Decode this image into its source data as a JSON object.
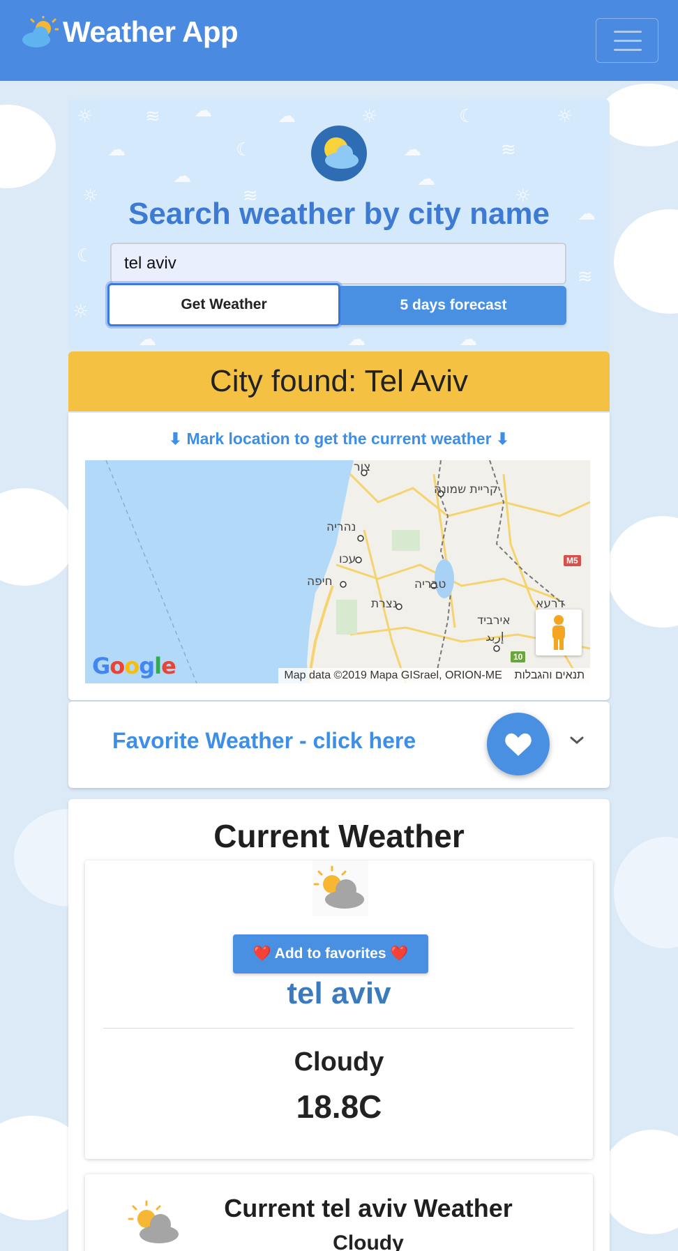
{
  "app": {
    "title": "Weather App",
    "menu_icon": "hamburger-icon"
  },
  "search": {
    "title": "Search weather by city name",
    "input_value": "tel aviv",
    "get_weather_label": "Get Weather",
    "forecast_label": "5 days forecast"
  },
  "city_found": {
    "text": "City found: Tel Aviv"
  },
  "map": {
    "instruction": "⬇ Mark location to get the current weather ⬇",
    "attribution": "Map data ©2019 Mapa GISrael, ORION-ME",
    "terms": "תנאים והגבלות",
    "google_logo": "Google",
    "labels": [
      "צור",
      "קריית שמונה",
      "נהריה",
      "עכו",
      "חיפה",
      "טבריה",
      "נצרת",
      "אירביד",
      "إربد",
      "דרעא"
    ],
    "shields": [
      "M5",
      "10"
    ]
  },
  "favorites": {
    "label": "Favorite Weather - click here"
  },
  "current": {
    "title": "Current Weather",
    "add_favorites_label": "❤️  Add to favorites ❤️",
    "city": "tel aviv",
    "condition": "Cloudy",
    "temperature": "18.8C",
    "secondary_title": "Current tel aviv Weather",
    "secondary_condition": "Cloudy"
  },
  "colors": {
    "navbar": "#4a8ae0",
    "accent_blue": "#4a90e2",
    "city_banner": "#f5c142",
    "search_card": "#d4e9fb"
  }
}
